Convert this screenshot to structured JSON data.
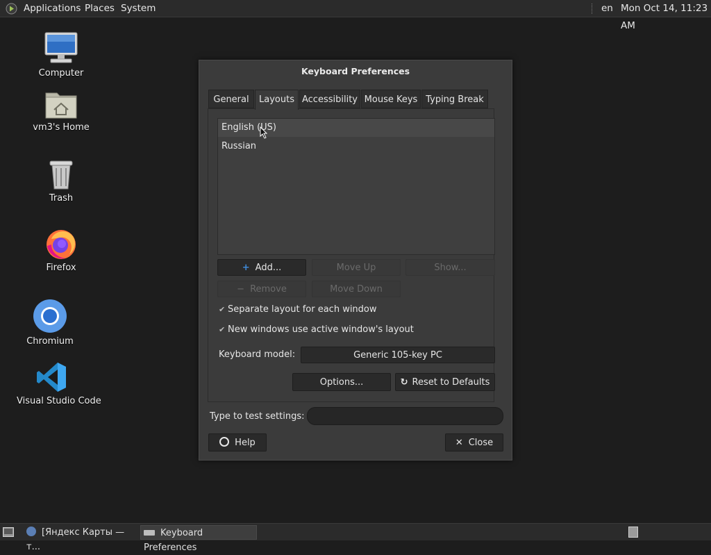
{
  "topbar": {
    "menus": [
      "Applications",
      "Places",
      "System"
    ],
    "keyboard_indicator": "en",
    "clock": "Mon Oct 14, 11:23 AM"
  },
  "desktop": {
    "icons": [
      {
        "label": "Computer",
        "icon": "computer-icon"
      },
      {
        "label": "vm3's Home",
        "icon": "home-folder-icon"
      },
      {
        "label": "Trash",
        "icon": "trash-icon"
      },
      {
        "label": "Firefox",
        "icon": "firefox-icon"
      },
      {
        "label": "Chromium",
        "icon": "chromium-icon"
      },
      {
        "label": "Visual Studio Code",
        "icon": "vscode-icon"
      }
    ]
  },
  "dialog": {
    "title": "Keyboard Preferences",
    "tabs": [
      {
        "label": "General",
        "active": false
      },
      {
        "label": "Layouts",
        "active": true
      },
      {
        "label": "Accessibility",
        "active": false
      },
      {
        "label": "Mouse Keys",
        "active": false
      },
      {
        "label": "Typing Break",
        "active": false
      }
    ],
    "layouts": [
      {
        "label": "English (US)",
        "selected": true
      },
      {
        "label": "Russian",
        "selected": false
      }
    ],
    "buttons": {
      "add": "Add...",
      "move_up": "Move Up",
      "show": "Show...",
      "remove": "Remove",
      "move_down": "Move Down",
      "options": "Options...",
      "reset": "Reset to Defaults",
      "help": "Help",
      "close": "Close"
    },
    "checkboxes": {
      "separate_layout": "Separate layout for each window",
      "new_windows": "New windows use active window's layout"
    },
    "keyboard_model_label": "Keyboard model:",
    "keyboard_model_value": "Generic 105-key PC",
    "test_label": "Type to test settings:",
    "test_value": ""
  },
  "taskbar": {
    "tasks": [
      {
        "label": "[Яндекс Карты — т...",
        "icon": "browser-icon",
        "active": false
      },
      {
        "label": "Keyboard Preferences",
        "icon": "keyboard-icon",
        "active": true
      }
    ]
  },
  "colors": {
    "background": "#1d1d1d",
    "dialog": "#3b3b3b",
    "button": "#2a2a2a",
    "accent_blue": "#3f8ad8"
  }
}
